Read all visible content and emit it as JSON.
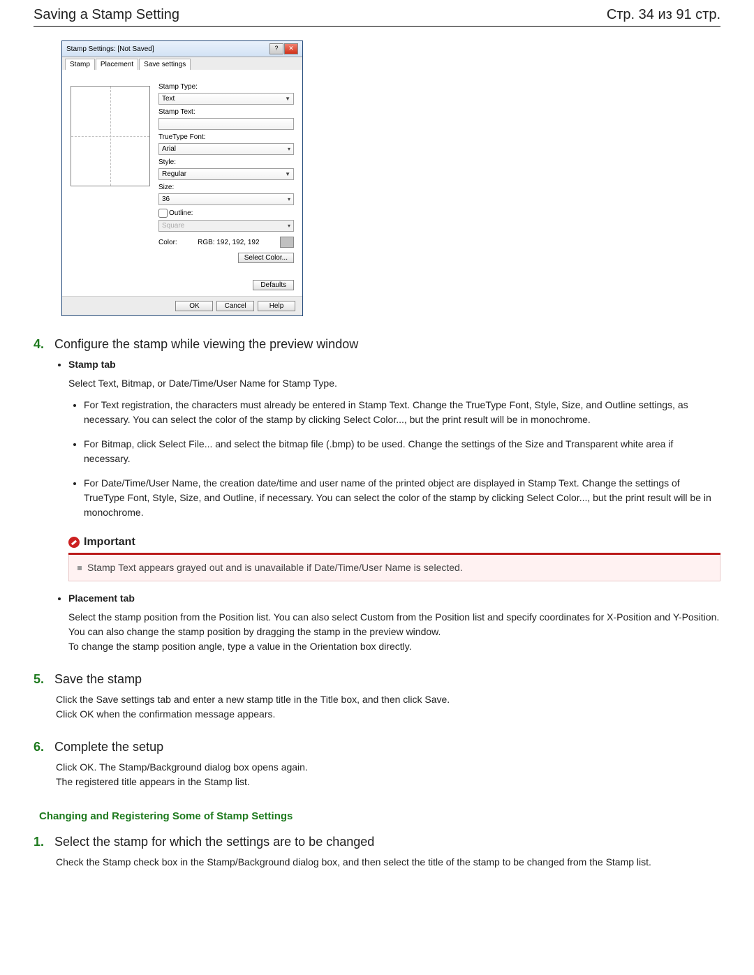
{
  "header": {
    "title": "Saving a Stamp Setting",
    "page_info": "Стр. 34 из 91 стр."
  },
  "dialog": {
    "title": "Stamp Settings: [Not Saved]",
    "help_btn": "?",
    "close_btn": "✕",
    "tabs": {
      "stamp": "Stamp",
      "placement": "Placement",
      "save": "Save settings"
    },
    "labels": {
      "stamp_type": "Stamp Type:",
      "stamp_text": "Stamp Text:",
      "font": "TrueType Font:",
      "style": "Style:",
      "size": "Size:",
      "outline": "Outline:",
      "color": "Color:"
    },
    "values": {
      "stamp_type": "Text",
      "stamp_text": "",
      "font": "Arial",
      "style": "Regular",
      "size": "36",
      "outline": "Square",
      "rgb": "RGB: 192, 192, 192",
      "color_hex": "#c0c0c0"
    },
    "buttons": {
      "select_color": "Select Color...",
      "defaults": "Defaults",
      "ok": "OK",
      "cancel": "Cancel",
      "help": "Help"
    }
  },
  "step4": {
    "num": "4.",
    "title": "Configure the stamp while viewing the preview window",
    "stamp_tab_label": "Stamp tab",
    "stamp_tab_intro": "Select Text, Bitmap, or Date/Time/User Name for Stamp Type.",
    "sub1": "For Text registration, the characters must already be entered in Stamp Text. Change the TrueType Font, Style, Size, and Outline settings, as necessary. You can select the color of the stamp by clicking Select Color..., but the print result will be in monochrome.",
    "sub2": "For Bitmap, click Select File... and select the bitmap file (.bmp) to be used. Change the settings of the Size and Transparent white area if necessary.",
    "sub3": "For Date/Time/User Name, the creation date/time and user name of the printed object are displayed in Stamp Text. Change the settings of TrueType Font, Style, Size, and Outline, if necessary. You can select the color of the stamp by clicking Select Color..., but the print result will be in monochrome.",
    "important_label": "Important",
    "important_text": "Stamp Text appears grayed out and is unavailable if Date/Time/User Name is selected.",
    "placement_tab_label": "Placement tab",
    "placement_p1": "Select the stamp position from the Position list. You can also select Custom from the Position list and specify coordinates for X-Position and Y-Position.",
    "placement_p2": "You can also change the stamp position by dragging the stamp in the preview window.",
    "placement_p3": "To change the stamp position angle, type a value in the Orientation box directly."
  },
  "step5": {
    "num": "5.",
    "title": "Save the stamp",
    "p1": "Click the Save settings tab and enter a new stamp title in the Title box, and then click Save.",
    "p2": "Click OK when the confirmation message appears."
  },
  "step6": {
    "num": "6.",
    "title": "Complete the setup",
    "p1": "Click OK. The Stamp/Background dialog box opens again.",
    "p2": "The registered title appears in the Stamp list."
  },
  "section2": {
    "heading": "Changing and Registering Some of Stamp Settings"
  },
  "stepB1": {
    "num": "1.",
    "title": "Select the stamp for which the settings are to be changed",
    "body": "Check the Stamp check box in the Stamp/Background dialog box, and then select the title of the stamp to be changed from the Stamp list."
  }
}
